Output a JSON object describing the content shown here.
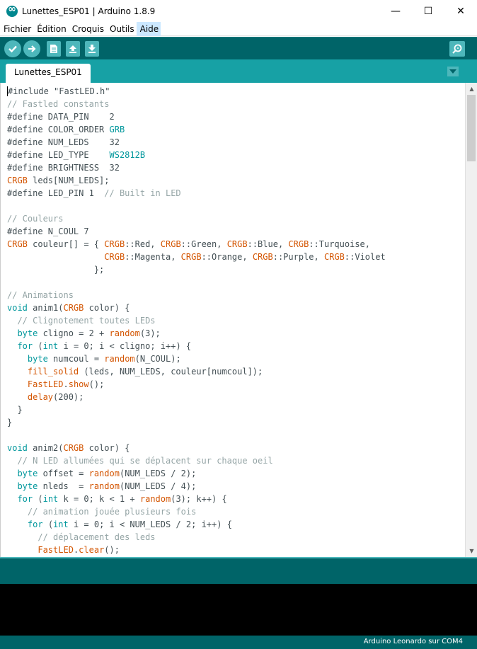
{
  "window": {
    "title": "Lunettes_ESP01 | Arduino 1.8.9",
    "minimize": "—",
    "maximize": "☐",
    "close": "✕"
  },
  "menu": {
    "items": [
      {
        "label": "Fichier"
      },
      {
        "label": "Édition"
      },
      {
        "label": "Croquis"
      },
      {
        "label": "Outils"
      },
      {
        "label": "Aide"
      }
    ]
  },
  "toolbar": {
    "buttons": [
      "verify-icon",
      "upload-icon",
      "new-icon",
      "open-icon",
      "save-icon",
      "serial-monitor-icon"
    ]
  },
  "tabs": [
    {
      "label": "Lunettes_ESP01"
    }
  ],
  "status": {
    "board": "Arduino Leonardo sur COM4"
  },
  "colors": {
    "toolbar": "#006468",
    "tabbar": "#17a1a5",
    "accent": "#4db7bb",
    "keyword": "#00979c",
    "type": "#d35400",
    "comment": "#95a5a6"
  },
  "code": [
    [
      [
        "p",
        "#include \"FastLED.h\""
      ]
    ],
    [
      [
        "c",
        "// Fastled constants"
      ]
    ],
    [
      [
        "p",
        "#define DATA_PIN    2"
      ]
    ],
    [
      [
        "p",
        "#define COLOR_ORDER "
      ],
      [
        "k",
        "GRB"
      ]
    ],
    [
      [
        "p",
        "#define NUM_LEDS    32"
      ]
    ],
    [
      [
        "p",
        "#define LED_TYPE    "
      ],
      [
        "k",
        "WS2812B"
      ]
    ],
    [
      [
        "p",
        "#define BRIGHTNESS  32"
      ]
    ],
    [
      [
        "t",
        "CRGB"
      ],
      [
        "p",
        " leds[NUM_LEDS];"
      ]
    ],
    [
      [
        "p",
        "#define LED_PIN 1  "
      ],
      [
        "c",
        "// Built in LED"
      ]
    ],
    [
      [
        "p",
        ""
      ]
    ],
    [
      [
        "c",
        "// Couleurs"
      ]
    ],
    [
      [
        "p",
        "#define N_COUL 7"
      ]
    ],
    [
      [
        "t",
        "CRGB"
      ],
      [
        "p",
        " couleur[] = { "
      ],
      [
        "t",
        "CRGB"
      ],
      [
        "p",
        "::Red, "
      ],
      [
        "t",
        "CRGB"
      ],
      [
        "p",
        "::Green, "
      ],
      [
        "t",
        "CRGB"
      ],
      [
        "p",
        "::Blue, "
      ],
      [
        "t",
        "CRGB"
      ],
      [
        "p",
        "::Turquoise,"
      ]
    ],
    [
      [
        "p",
        "                   "
      ],
      [
        "t",
        "CRGB"
      ],
      [
        "p",
        "::Magenta, "
      ],
      [
        "t",
        "CRGB"
      ],
      [
        "p",
        "::Orange, "
      ],
      [
        "t",
        "CRGB"
      ],
      [
        "p",
        "::Purple, "
      ],
      [
        "t",
        "CRGB"
      ],
      [
        "p",
        "::Violet"
      ]
    ],
    [
      [
        "p",
        "                 };"
      ]
    ],
    [
      [
        "p",
        ""
      ]
    ],
    [
      [
        "c",
        "// Animations"
      ]
    ],
    [
      [
        "k",
        "void"
      ],
      [
        "p",
        " anim1("
      ],
      [
        "t",
        "CRGB"
      ],
      [
        "p",
        " color) {"
      ]
    ],
    [
      [
        "c",
        "  // Clignotement toutes LEDs"
      ]
    ],
    [
      [
        "p",
        "  "
      ],
      [
        "k",
        "byte"
      ],
      [
        "p",
        " cligno = 2 + "
      ],
      [
        "f",
        "random"
      ],
      [
        "p",
        "(3);"
      ]
    ],
    [
      [
        "p",
        "  "
      ],
      [
        "k",
        "for"
      ],
      [
        "p",
        " ("
      ],
      [
        "k",
        "int"
      ],
      [
        "p",
        " i = 0; i < cligno; i++) {"
      ]
    ],
    [
      [
        "p",
        "    "
      ],
      [
        "k",
        "byte"
      ],
      [
        "p",
        " numcoul = "
      ],
      [
        "f",
        "random"
      ],
      [
        "p",
        "(N_COUL);"
      ]
    ],
    [
      [
        "p",
        "    "
      ],
      [
        "f",
        "fill_solid"
      ],
      [
        "p",
        " (leds, NUM_LEDS, couleur[numcoul]);"
      ]
    ],
    [
      [
        "p",
        "    "
      ],
      [
        "t",
        "FastLED"
      ],
      [
        "p",
        "."
      ],
      [
        "f",
        "show"
      ],
      [
        "p",
        "();"
      ]
    ],
    [
      [
        "p",
        "    "
      ],
      [
        "f",
        "delay"
      ],
      [
        "p",
        "(200);"
      ]
    ],
    [
      [
        "p",
        "  }"
      ]
    ],
    [
      [
        "p",
        "}"
      ]
    ],
    [
      [
        "p",
        ""
      ]
    ],
    [
      [
        "k",
        "void"
      ],
      [
        "p",
        " anim2("
      ],
      [
        "t",
        "CRGB"
      ],
      [
        "p",
        " color) {"
      ]
    ],
    [
      [
        "c",
        "  // N LED allumées qui se déplacent sur chaque oeil"
      ]
    ],
    [
      [
        "p",
        "  "
      ],
      [
        "k",
        "byte"
      ],
      [
        "p",
        " offset = "
      ],
      [
        "f",
        "random"
      ],
      [
        "p",
        "(NUM_LEDS / 2);"
      ]
    ],
    [
      [
        "p",
        "  "
      ],
      [
        "k",
        "byte"
      ],
      [
        "p",
        " nleds  = "
      ],
      [
        "f",
        "random"
      ],
      [
        "p",
        "(NUM_LEDS / 4);"
      ]
    ],
    [
      [
        "p",
        "  "
      ],
      [
        "k",
        "for"
      ],
      [
        "p",
        " ("
      ],
      [
        "k",
        "int"
      ],
      [
        "p",
        " k = 0; k < 1 + "
      ],
      [
        "f",
        "random"
      ],
      [
        "p",
        "(3); k++) {"
      ]
    ],
    [
      [
        "c",
        "    // animation jouée plusieurs fois"
      ]
    ],
    [
      [
        "p",
        "    "
      ],
      [
        "k",
        "for"
      ],
      [
        "p",
        " ("
      ],
      [
        "k",
        "int"
      ],
      [
        "p",
        " i = 0; i < NUM_LEDS / 2; i++) {"
      ]
    ],
    [
      [
        "c",
        "      // déplacement des leds"
      ]
    ],
    [
      [
        "p",
        "      "
      ],
      [
        "t",
        "FastLED"
      ],
      [
        "p",
        "."
      ],
      [
        "f",
        "clear"
      ],
      [
        "p",
        "();"
      ]
    ]
  ]
}
